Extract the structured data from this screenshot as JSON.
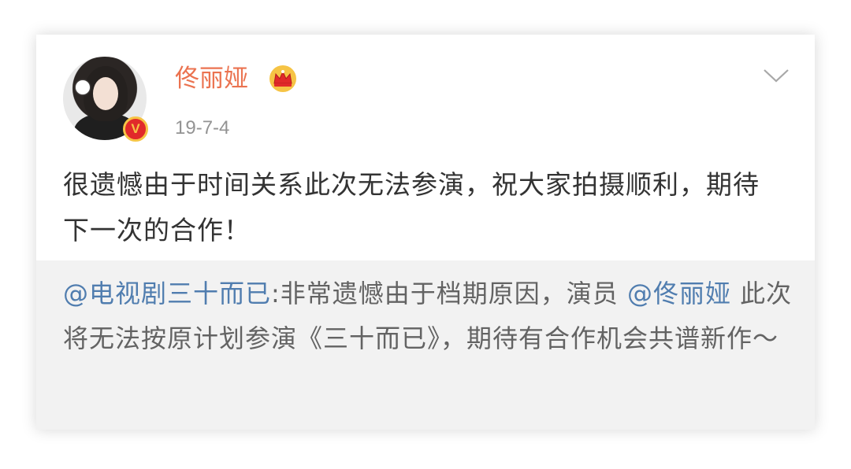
{
  "post": {
    "username": "佟丽娅",
    "verified_badge": "V",
    "timestamp": "19-7-4",
    "text": "很遗憾由于时间关系此次无法参演，祝大家拍摄顺利，期待下一次的合作！",
    "icons": {
      "crown": "crown-icon",
      "menu": "chevron-down-icon",
      "verified": "verified-v-icon"
    }
  },
  "repost": {
    "source_mention": "@电视剧三十而已",
    "separator": ":",
    "text_part1": "非常遗憾由于档期原因，演员 ",
    "inner_mention": "@佟丽娅",
    "text_part2": " 此次将无法按原计划参演《三十而已》，期待有合作机会共谱新作～"
  },
  "colors": {
    "username": "#eb7350",
    "mention": "#507daf",
    "body_text": "#333333",
    "repost_bg": "#f2f2f2",
    "timestamp": "#939393"
  }
}
